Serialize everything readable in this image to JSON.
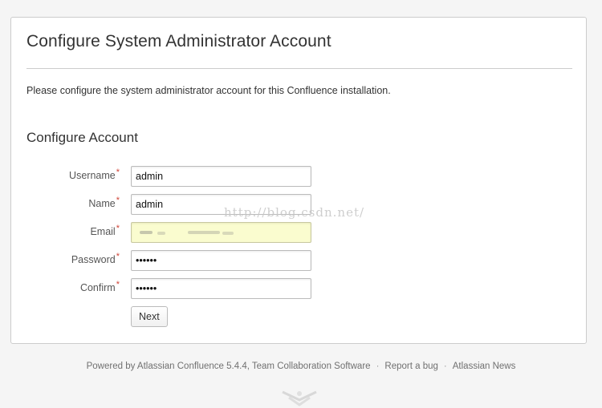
{
  "header": {
    "title": "Configure System Administrator Account",
    "intro": "Please configure the system administrator account for this Confluence installation."
  },
  "form": {
    "section_title": "Configure Account",
    "required_marker": "*",
    "fields": [
      {
        "label": "Username",
        "value": "admin",
        "type": "text"
      },
      {
        "label": "Name",
        "value": "admin",
        "type": "text"
      },
      {
        "label": "Email",
        "value": "",
        "type": "text"
      },
      {
        "label": "Password",
        "value": "aaaaaa",
        "type": "password"
      },
      {
        "label": "Confirm",
        "value": "aaaaaa",
        "type": "password"
      }
    ],
    "next_label": "Next"
  },
  "watermark": "http://blog.csdn.net/",
  "footer": {
    "powered_by": "Powered by Atlassian Confluence 5.4.4, Team Collaboration Software",
    "separator": "·",
    "report_bug": "Report a bug",
    "news": "Atlassian News"
  },
  "colors": {
    "required": "#d04437",
    "autofill": "#fafccf"
  }
}
